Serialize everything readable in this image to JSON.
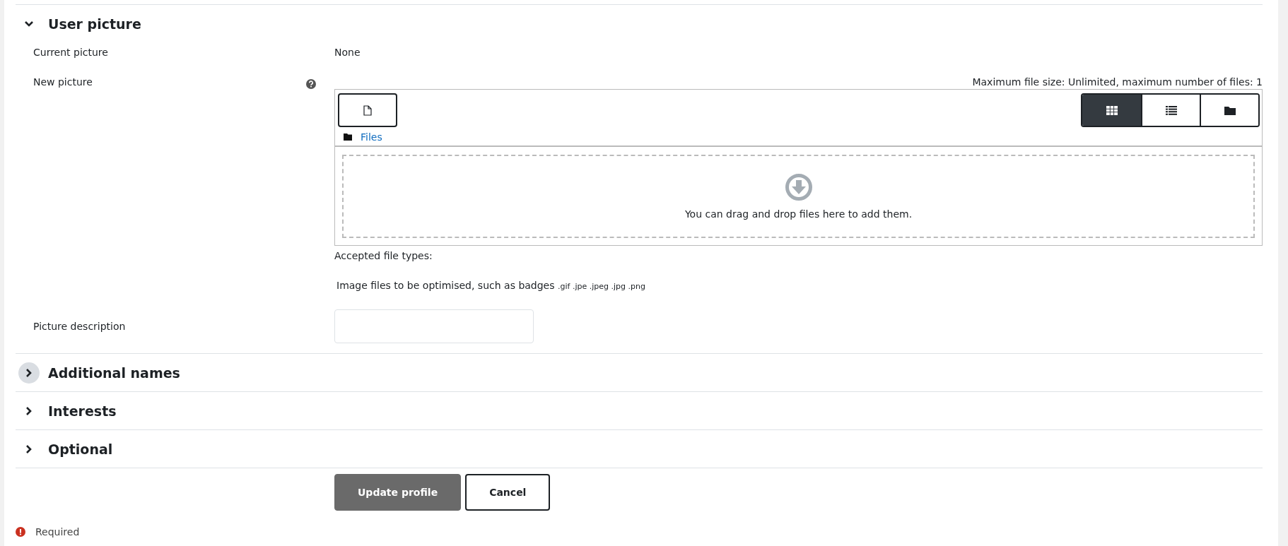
{
  "sections": [
    {
      "title": "User picture",
      "expanded": true,
      "hovered": false
    },
    {
      "title": "Additional names",
      "expanded": false,
      "hovered": true
    },
    {
      "title": "Interests",
      "expanded": false,
      "hovered": false
    },
    {
      "title": "Optional",
      "expanded": false,
      "hovered": false
    }
  ],
  "user_picture": {
    "current_picture": {
      "label": "Current picture",
      "value": "None"
    },
    "new_picture": {
      "label": "New picture",
      "limits": "Maximum file size: Unlimited, maximum number of files: 1",
      "view_modes": [
        {
          "kind": "grid",
          "selected": true
        },
        {
          "kind": "list",
          "selected": false
        },
        {
          "kind": "tree",
          "selected": false
        }
      ],
      "path": "Files",
      "dropzone_text": "You can drag and drop files here to add them.",
      "accepted_label": "Accepted file types:",
      "accepted_description": "Image files to be optimised, such as badges",
      "accepted_extensions": ".gif .jpe .jpeg .jpg .png"
    },
    "picture_description": {
      "label": "Picture description"
    }
  },
  "buttons": [
    {
      "label": "Update profile",
      "kind": "primary"
    },
    {
      "label": "Cancel",
      "kind": "secondary"
    }
  ],
  "required_note": "Required"
}
